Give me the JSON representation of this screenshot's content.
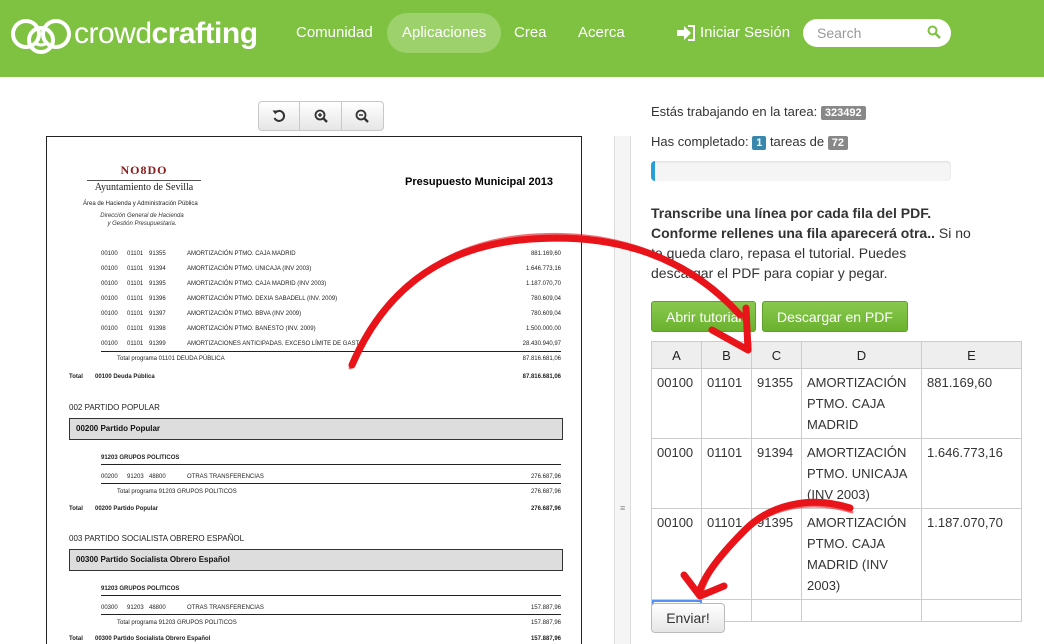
{
  "navbar": {
    "brand_light": "crowd",
    "brand_bold": "crafting",
    "items": [
      {
        "label": "Comunidad",
        "active": false
      },
      {
        "label": "Aplicaciones",
        "active": true
      },
      {
        "label": "Crea",
        "active": false
      },
      {
        "label": "Acerca",
        "active": false
      }
    ],
    "login_label": "Iniciar Sesión",
    "search_placeholder": "Search"
  },
  "colors": {
    "brand": "#7fc242",
    "accent": "#2a9fd6",
    "annotation_arrow": "#e8141a"
  },
  "viewer": {
    "tools": [
      {
        "icon": "rotate-icon"
      },
      {
        "icon": "zoom-in-icon"
      },
      {
        "icon": "zoom-out-icon"
      }
    ],
    "pdf": {
      "logo_top": "NO8DO",
      "logo_bottom": "Ayuntamiento de Sevilla",
      "area": "Área de Hacienda y Administración Pública",
      "direction_1": "Dirección General de Hacienda",
      "direction_2": "y Gestión Presupuestaria.",
      "title": "Presupuesto Municipal 2013",
      "rows": [
        {
          "a": "00100",
          "b": "01101",
          "c": "91355",
          "d": "AMORTIZACIÓN PTMO. CAJA MADRID",
          "e": "881.169,60"
        },
        {
          "a": "00100",
          "b": "01101",
          "c": "91394",
          "d": "AMORTIZACIÓN PTMO. UNICAJA (INV 2003)",
          "e": "1.646.773,16"
        },
        {
          "a": "00100",
          "b": "01101",
          "c": "91395",
          "d": "AMORTIZACIÓN PTMO. CAJA MADRID (INV 2003)",
          "e": "1.187.070,70"
        },
        {
          "a": "00100",
          "b": "01101",
          "c": "91396",
          "d": "AMORTIZACIÓN PTMO. DEXIA SABADELL (INV. 2009)",
          "e": "780.609,04"
        },
        {
          "a": "00100",
          "b": "01101",
          "c": "91397",
          "d": "AMORTIZACIÓN PTMO. BBVA (INV 2009)",
          "e": "780.609,04"
        },
        {
          "a": "00100",
          "b": "01101",
          "c": "91398",
          "d": "AMORTIZACIÓN PTMO. BANESTO (INV. 2009)",
          "e": "1.500.000,00"
        },
        {
          "a": "00100",
          "b": "01101",
          "c": "91399",
          "d": "AMORTIZACIONES ANTICIPADAS. EXCESO LÍMITE DE GASTO",
          "e": "28.430.940,97"
        }
      ],
      "total_programa_1": "Total programa 01101 DEUDA PÚBLICA",
      "total_programa_1_value": "87.816.681,06",
      "total_1_label": "Total",
      "total_1_name": "00100 Deuda Pública",
      "total_1_value": "87.816.681,06",
      "section_2": "002 PARTIDO POPULAR",
      "box_2": "00200 Partido Popular",
      "group_2": "91203 GRUPOS POLITICOS",
      "row_2": {
        "a": "00200",
        "b": "91203",
        "c": "48800",
        "d": "OTRAS TRANSFERENCIAS",
        "e": "276.687,96"
      },
      "total_programa_2": "Total programa 91203 GRUPOS POLITICOS",
      "total_programa_2_value": "276.687,96",
      "total_2_label": "Total",
      "total_2_name": "00200 Partido Popular",
      "total_2_value": "276.687,96",
      "section_3": "003 PARTIDO SOCIALISTA OBRERO ESPAÑOL",
      "box_3": "00300 Partido Socialista Obrero Español",
      "group_3": "91203 GRUPOS POLITICOS",
      "row_3": {
        "a": "00300",
        "b": "91203",
        "c": "48800",
        "d": "OTRAS TRANSFERENCIAS",
        "e": "157.887,96"
      },
      "total_programa_3": "Total programa 91203 GRUPOS POLITICOS",
      "total_programa_3_value": "157.887,96",
      "total_3_label": "Total",
      "total_3_name": "00300 Partido Socialista Obrero Español",
      "total_3_value": "157.887,96"
    }
  },
  "task": {
    "working_label": "Estás trabajando en la tarea:",
    "task_id": "323492",
    "completed_label": "Has completado:",
    "completed": "1",
    "of_label": "tareas de",
    "total": "72",
    "progress": 0.0139
  },
  "instructions": {
    "bold": "Transcribe una línea por cada fila del PDF. Conforme rellenes una fila aparecerá otra..",
    "normal": "Si no te queda claro, repasa el tutorial. Puedes descargar el PDF para copiar y pegar."
  },
  "buttons": {
    "tutorial": "Abrir tutorial",
    "download": "Descargar en PDF",
    "submit": "Enviar!"
  },
  "sheet": {
    "columns": [
      "A",
      "B",
      "C",
      "D",
      "E"
    ],
    "rows": [
      [
        "00100",
        "01101",
        "91355",
        "AMORTIZACIÓN PTMO. CAJA MADRID",
        "881.169,60"
      ],
      [
        "00100",
        "01101",
        "91394",
        "AMORTIZACIÓN PTMO. UNICAJA (INV 2003)",
        "1.646.773,16"
      ],
      [
        "00100",
        "01101",
        "91395",
        "AMORTIZACIÓN PTMO. CAJA MADRID (INV 2003)",
        "1.187.070,70"
      ],
      [
        "",
        "",
        "",
        "",
        ""
      ]
    ]
  }
}
